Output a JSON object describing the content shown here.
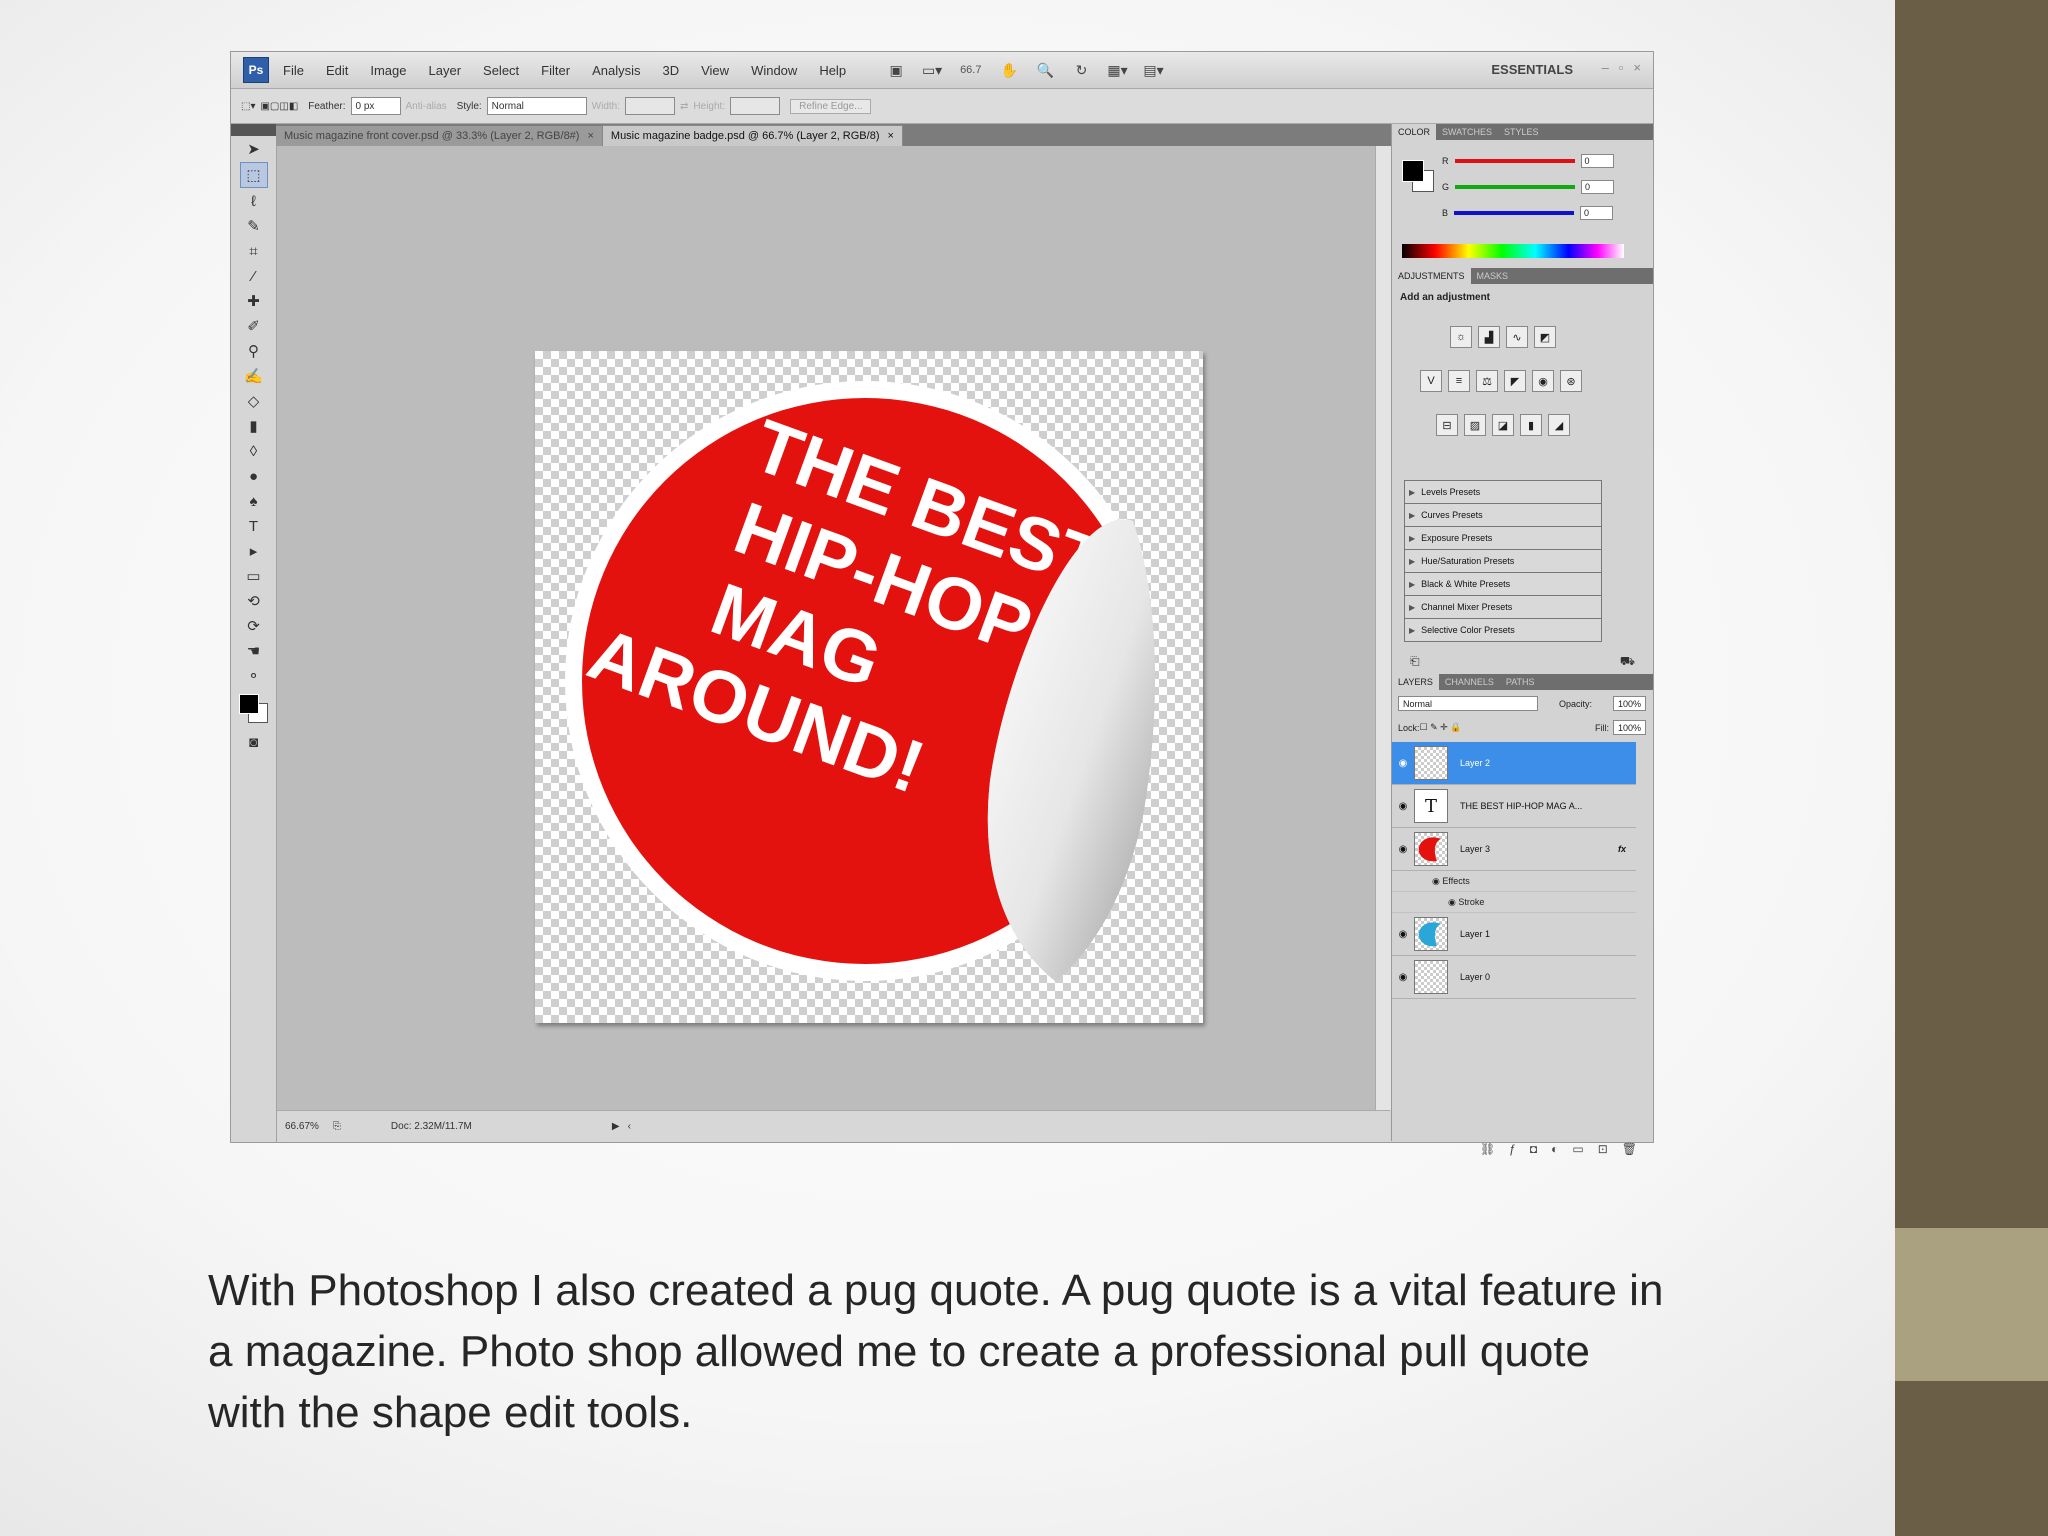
{
  "menubar": {
    "logo": "Ps",
    "items": [
      "File",
      "Edit",
      "Image",
      "Layer",
      "Select",
      "Filter",
      "Analysis",
      "3D",
      "View",
      "Window",
      "Help"
    ],
    "zoom": "66.7",
    "workspace": "ESSENTIALS"
  },
  "options": {
    "feather_label": "Feather:",
    "feather_value": "0 px",
    "antialias": "Anti-alias",
    "style_label": "Style:",
    "style_value": "Normal",
    "width_label": "Width:",
    "height_label": "Height:",
    "refine_button": "Refine Edge..."
  },
  "doc_tabs": [
    {
      "label": "Music magazine front cover.psd @ 33.3% (Layer 2, RGB/8#)"
    },
    {
      "label": "Music magazine badge.psd @ 66.7% (Layer 2, RGB/8)"
    }
  ],
  "badge_text": [
    "THE BEST",
    "HIP-HOP",
    "MAG",
    "AROUND!"
  ],
  "status": {
    "zoom": "66.67%",
    "doc": "Doc: 2.32M/11.7M"
  },
  "color_panel": {
    "tabs": [
      "COLOR",
      "SWATCHES",
      "STYLES"
    ],
    "channels": [
      {
        "name": "R",
        "value": "0",
        "color": "#d11"
      },
      {
        "name": "G",
        "value": "0",
        "color": "#1a1"
      },
      {
        "name": "B",
        "value": "0",
        "color": "#11c"
      }
    ]
  },
  "adjustments": {
    "tabs": [
      "ADJUSTMENTS",
      "MASKS"
    ],
    "title": "Add an adjustment",
    "presets": [
      "Levels Presets",
      "Curves Presets",
      "Exposure Presets",
      "Hue/Saturation Presets",
      "Black & White Presets",
      "Channel Mixer Presets",
      "Selective Color Presets"
    ]
  },
  "layers_panel": {
    "tabs": [
      "LAYERS",
      "CHANNELS",
      "PATHS"
    ],
    "blend_mode": "Normal",
    "opacity_label": "Opacity:",
    "opacity": "100%",
    "lock_label": "Lock:",
    "fill_label": "Fill:",
    "fill": "100%",
    "layers": [
      {
        "name": "Layer 2"
      },
      {
        "name": "THE BEST HIP-HOP MAG A..."
      },
      {
        "name": "Layer 3"
      },
      {
        "name": "Layer 1"
      },
      {
        "name": "Layer 0"
      }
    ],
    "effects_label": "Effects",
    "stroke_label": "Stroke",
    "fx_label": "fx"
  },
  "caption": "With Photoshop I also created a pug quote. A pug quote is a vital feature in a magazine. Photo shop allowed me to create a professional pull quote with the shape edit tools.",
  "colors": {
    "sidebar": "#6b5e47",
    "sidebar_accent": "#a9a17f",
    "badge_red": "#e3120f",
    "selected_layer": "#3d8ee8"
  }
}
